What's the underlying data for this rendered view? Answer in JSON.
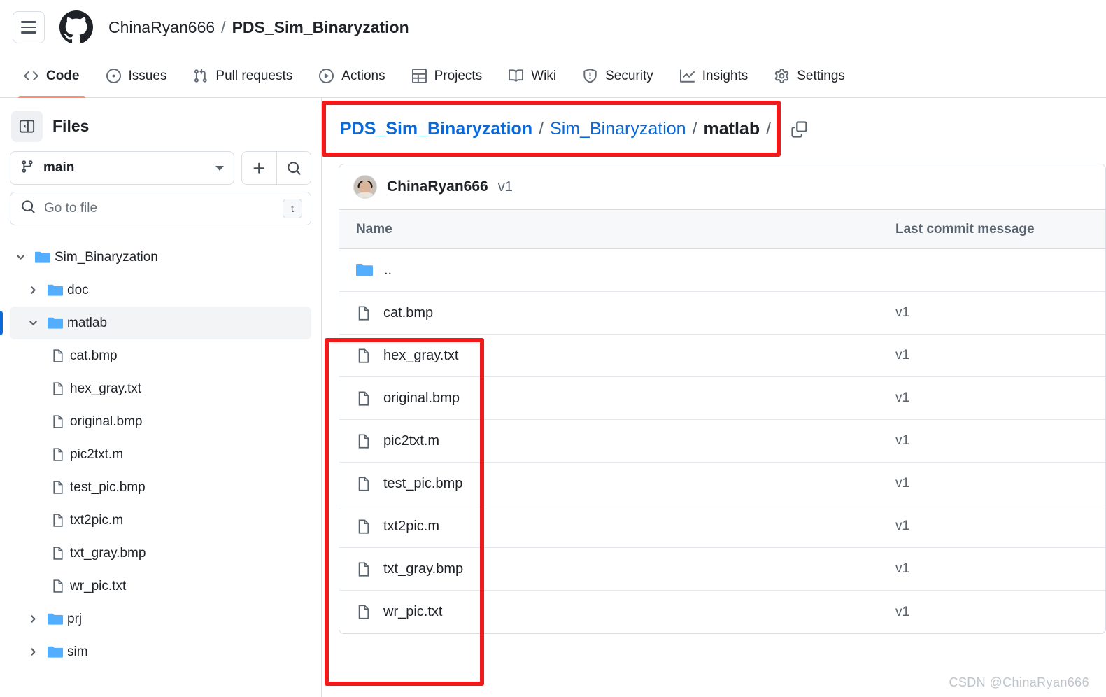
{
  "header": {
    "menu_icon": "hamburger-icon",
    "logo_icon": "github-logo-icon",
    "owner": "ChinaRyan666",
    "separator": "/",
    "repo": "PDS_Sim_Binaryzation"
  },
  "repo_nav": {
    "tabs": [
      {
        "label": "Code",
        "icon": "code-icon",
        "active": true
      },
      {
        "label": "Issues",
        "icon": "issue-opened-icon",
        "active": false
      },
      {
        "label": "Pull requests",
        "icon": "git-pull-request-icon",
        "active": false
      },
      {
        "label": "Actions",
        "icon": "play-icon",
        "active": false
      },
      {
        "label": "Projects",
        "icon": "table-icon",
        "active": false
      },
      {
        "label": "Wiki",
        "icon": "book-icon",
        "active": false
      },
      {
        "label": "Security",
        "icon": "shield-icon",
        "active": false
      },
      {
        "label": "Insights",
        "icon": "graph-icon",
        "active": false
      },
      {
        "label": "Settings",
        "icon": "gear-icon",
        "active": false
      }
    ]
  },
  "sidebar": {
    "panel_title": "Files",
    "collapse_icon": "sidebar-collapse-icon",
    "branch": {
      "icon": "git-branch-icon",
      "name": "main",
      "caret_icon": "chevron-down-icon"
    },
    "add_button_icon": "plus-icon",
    "search_button_icon": "search-icon",
    "go_to_file": {
      "icon": "search-icon",
      "placeholder": "Go to file",
      "value": "",
      "shortcut": "t"
    },
    "tree": [
      {
        "label": "Sim_Binaryzation",
        "type": "folder",
        "state": "expanded",
        "depth": 1,
        "selected": false
      },
      {
        "label": "doc",
        "type": "folder",
        "state": "collapsed",
        "depth": 2,
        "selected": false
      },
      {
        "label": "matlab",
        "type": "folder",
        "state": "expanded",
        "depth": 2,
        "selected": true
      },
      {
        "label": "cat.bmp",
        "type": "file",
        "state": "none",
        "depth": 3,
        "selected": false
      },
      {
        "label": "hex_gray.txt",
        "type": "file",
        "state": "none",
        "depth": 3,
        "selected": false
      },
      {
        "label": "original.bmp",
        "type": "file",
        "state": "none",
        "depth": 3,
        "selected": false
      },
      {
        "label": "pic2txt.m",
        "type": "file",
        "state": "none",
        "depth": 3,
        "selected": false
      },
      {
        "label": "test_pic.bmp",
        "type": "file",
        "state": "none",
        "depth": 3,
        "selected": false
      },
      {
        "label": "txt2pic.m",
        "type": "file",
        "state": "none",
        "depth": 3,
        "selected": false
      },
      {
        "label": "txt_gray.bmp",
        "type": "file",
        "state": "none",
        "depth": 3,
        "selected": false
      },
      {
        "label": "wr_pic.txt",
        "type": "file",
        "state": "none",
        "depth": 3,
        "selected": false
      },
      {
        "label": "prj",
        "type": "folder",
        "state": "collapsed",
        "depth": 2,
        "selected": false
      },
      {
        "label": "sim",
        "type": "folder",
        "state": "collapsed",
        "depth": 2,
        "selected": false
      }
    ]
  },
  "main": {
    "breadcrumb": {
      "parts": [
        {
          "text": "PDS_Sim_Binaryzation",
          "kind": "link-bold"
        },
        {
          "text": "/",
          "kind": "slash"
        },
        {
          "text": "Sim_Binaryzation",
          "kind": "link"
        },
        {
          "text": "/",
          "kind": "slash"
        },
        {
          "text": "matlab",
          "kind": "current"
        },
        {
          "text": "/",
          "kind": "slash"
        }
      ],
      "copy_icon": "copy-path-icon"
    },
    "latest_commit": {
      "avatar": "user-avatar",
      "author": "ChinaRyan666",
      "message": "v1"
    },
    "table": {
      "columns": [
        "Name",
        "Last commit message"
      ],
      "rows": [
        {
          "name": "..",
          "type": "parent-folder",
          "commit": ""
        },
        {
          "name": "cat.bmp",
          "type": "file",
          "commit": "v1"
        },
        {
          "name": "hex_gray.txt",
          "type": "file",
          "commit": "v1"
        },
        {
          "name": "original.bmp",
          "type": "file",
          "commit": "v1"
        },
        {
          "name": "pic2txt.m",
          "type": "file",
          "commit": "v1"
        },
        {
          "name": "test_pic.bmp",
          "type": "file",
          "commit": "v1"
        },
        {
          "name": "txt2pic.m",
          "type": "file",
          "commit": "v1"
        },
        {
          "name": "txt_gray.bmp",
          "type": "file",
          "commit": "v1"
        },
        {
          "name": "wr_pic.txt",
          "type": "file",
          "commit": "v1"
        }
      ]
    }
  },
  "annotations": {
    "highlight_color": "#f01a1a",
    "breadcrumb_box": "red-rectangle-around-breadcrumb",
    "filelist_box": "red-rectangle-around-file-names"
  },
  "watermark": "CSDN @ChinaRyan666",
  "colors": {
    "accent_blue": "#0969da",
    "active_tab_underline": "#fd8c73",
    "folder_blue": "#54aeff",
    "border": "#d8dee4"
  }
}
